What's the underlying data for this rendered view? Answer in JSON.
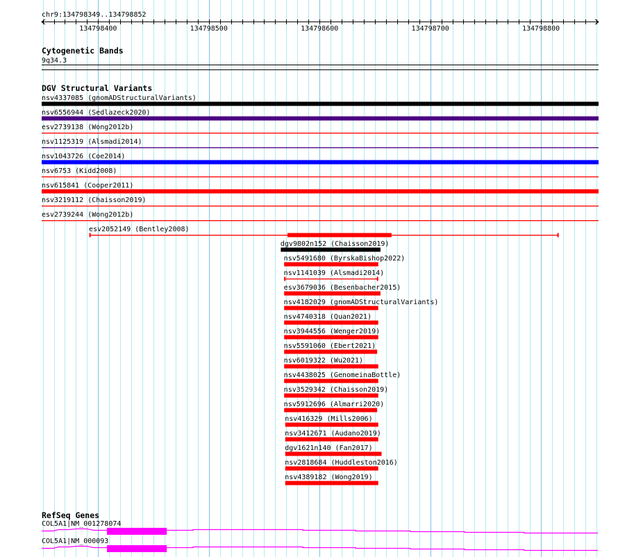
{
  "ruler": {
    "location": "chr9:134798349..134798852",
    "start": 134798349,
    "end": 134798852,
    "tick_labels": [
      "134798400",
      "134798500",
      "134798600",
      "134798700",
      "134798800"
    ]
  },
  "cytobands": {
    "title": "Cytogenetic Bands",
    "band": "9q34.3"
  },
  "dgv": {
    "title": "DGV Structural Variants",
    "colors": {
      "black": "#000000",
      "purple": "#4b0082",
      "blue": "#0000ff",
      "red": "#ff0000"
    },
    "variants": [
      {
        "label": "nsv4337085 (gnomADStructuralVariants)",
        "color": "#000000",
        "style": "thick",
        "start": 134798349,
        "end": 134798852
      },
      {
        "label": "nsv6556944 (Sedlazeck2020)",
        "color": "#4b0082",
        "style": "thick",
        "start": 134798349,
        "end": 134798852
      },
      {
        "label": "esv2739138 (Wong2012b)",
        "color": "#ff0000",
        "style": "thin",
        "start": 134798349,
        "end": 134798852
      },
      {
        "label": "nsv1125319 (Alsmadi2014)",
        "color": "#4b0082",
        "style": "thin",
        "start": 134798349,
        "end": 134798852
      },
      {
        "label": "nsv1043726 (Coe2014)",
        "color": "#0000ff",
        "style": "thick",
        "start": 134798349,
        "end": 134798852
      },
      {
        "label": "nsv6753 (Kidd2008)",
        "color": "#ff0000",
        "style": "thin",
        "start": 134798349,
        "end": 134798852
      },
      {
        "label": "nsv615841 (Cooper2011)",
        "color": "#ff0000",
        "style": "thick",
        "start": 134798349,
        "end": 134798852
      },
      {
        "label": "nsv3219112 (Chaisson2019)",
        "color": "#ff0000",
        "style": "thin",
        "start": 134798349,
        "end": 134798852
      },
      {
        "label": "esv2739244 (Wong2012b)",
        "color": "#ff0000",
        "style": "thin",
        "start": 134798349,
        "end": 134798852
      },
      {
        "label": "esv2052149 (Bentley2008)",
        "color": "#ff0000",
        "style": "span",
        "start": 134798392,
        "end": 134798816,
        "thick_start": 134798571,
        "thick_end": 134798665
      },
      {
        "label": "dgv9802n152 (Chaisson2019)",
        "color": "#000000",
        "style": "thick",
        "start": 134798565,
        "end": 134798655
      },
      {
        "label": "nsv5491680 (ByrskaBishop2022)",
        "color": "#ff0000",
        "style": "thick",
        "start": 134798568,
        "end": 134798653
      },
      {
        "label": "nsv1141039 (Alsmadi2014)",
        "color": "#ff0000",
        "style": "span",
        "start": 134798568,
        "end": 134798653
      },
      {
        "label": "esv3679036 (Besenbacher2015)",
        "color": "#ff0000",
        "style": "thick",
        "start": 134798568,
        "end": 134798655
      },
      {
        "label": "nsv4182029 (gnomADStructuralVariants)",
        "color": "#ff0000",
        "style": "thick",
        "start": 134798568,
        "end": 134798653
      },
      {
        "label": "nsv4740318 (Quan2021)",
        "color": "#ff0000",
        "style": "thick",
        "start": 134798568,
        "end": 134798653
      },
      {
        "label": "nsv3944556 (Wenger2019)",
        "color": "#ff0000",
        "style": "thick",
        "start": 134798568,
        "end": 134798653
      },
      {
        "label": "nsv5591060 (Ebert2021)",
        "color": "#ff0000",
        "style": "thick",
        "start": 134798568,
        "end": 134798652
      },
      {
        "label": "nsv6019322 (Wu2021)",
        "color": "#ff0000",
        "style": "thick",
        "start": 134798568,
        "end": 134798653
      },
      {
        "label": "nsv4438025 (GenomeinaBottle)",
        "color": "#ff0000",
        "style": "thick",
        "start": 134798568,
        "end": 134798653
      },
      {
        "label": "nsv3529342 (Chaisson2019)",
        "color": "#ff0000",
        "style": "thick",
        "start": 134798568,
        "end": 134798653
      },
      {
        "label": "nsv5912696 (Almarri2020)",
        "color": "#ff0000",
        "style": "thick",
        "start": 134798568,
        "end": 134798652
      },
      {
        "label": "nsv416329 (Mills2006)",
        "color": "#ff0000",
        "style": "thick",
        "start": 134798569,
        "end": 134798653
      },
      {
        "label": "nsv3412671 (Audano2019)",
        "color": "#ff0000",
        "style": "thick",
        "start": 134798569,
        "end": 134798653
      },
      {
        "label": "dgv1621n140 (Fan2017)",
        "color": "#ff0000",
        "style": "thick",
        "start": 134798569,
        "end": 134798656
      },
      {
        "label": "nsv2818684 (Huddleston2016)",
        "color": "#ff0000",
        "style": "thick",
        "start": 134798569,
        "end": 134798653
      },
      {
        "label": "nsv4389182 (Wong2019)",
        "color": "#ff0000",
        "style": "thick",
        "start": 134798569,
        "end": 134798653
      }
    ]
  },
  "refseq": {
    "title": "RefSeq Genes",
    "color": "#ff00ff",
    "transcripts": [
      {
        "label": "COL5A1|NM_001278074",
        "exon_start": 134798408,
        "exon_end": 134798462
      },
      {
        "label": "COL5A1|NM_000093",
        "exon_start": 134798408,
        "exon_end": 134798462
      }
    ]
  }
}
